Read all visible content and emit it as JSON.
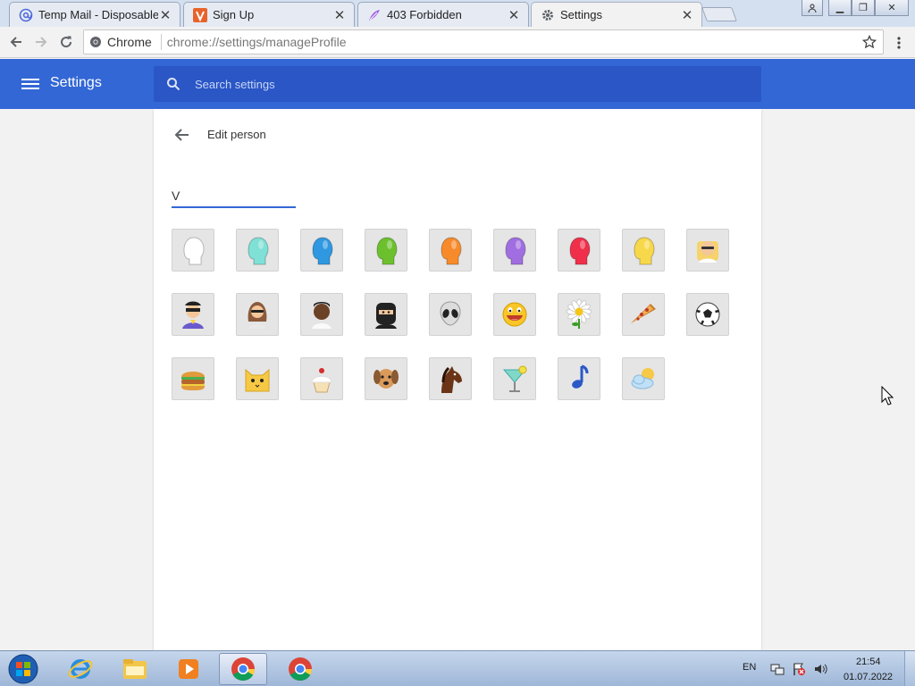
{
  "browser": {
    "tabs": [
      {
        "title": "Temp Mail - Disposable T",
        "icon": "at-icon"
      },
      {
        "title": "Sign Up",
        "icon": "v-logo-icon"
      },
      {
        "title": "403 Forbidden",
        "icon": "feather-icon"
      },
      {
        "title": "Settings",
        "icon": "gear-icon",
        "active": true
      }
    ],
    "omnibox": {
      "chip": "Chrome",
      "url": "chrome://settings/manageProfile"
    }
  },
  "settings": {
    "title": "Settings",
    "search_placeholder": "Search settings"
  },
  "edit_person": {
    "title": "Edit person",
    "name_value": "V",
    "avatars": [
      {
        "name": "avatar-generic-white",
        "icon": "head-silhouette-icon",
        "color": "#ffffff"
      },
      {
        "name": "avatar-generic-aqua",
        "icon": "head-silhouette-icon",
        "color": "#7fe0d6"
      },
      {
        "name": "avatar-generic-blue",
        "icon": "head-silhouette-icon",
        "color": "#2f98e0"
      },
      {
        "name": "avatar-generic-green",
        "icon": "head-silhouette-icon",
        "color": "#6cc02e"
      },
      {
        "name": "avatar-generic-orange",
        "icon": "head-silhouette-icon",
        "color": "#f78a2a"
      },
      {
        "name": "avatar-generic-purple",
        "icon": "head-silhouette-icon",
        "color": "#a06ee0"
      },
      {
        "name": "avatar-generic-red",
        "icon": "head-silhouette-icon",
        "color": "#f0304a"
      },
      {
        "name": "avatar-generic-yellow",
        "icon": "head-silhouette-icon",
        "color": "#f7d84a"
      },
      {
        "name": "avatar-businessman",
        "icon": "businessman-icon",
        "color": "#f3c79a"
      },
      {
        "name": "avatar-superhero",
        "icon": "superhero-icon",
        "color": "#6a5acd"
      },
      {
        "name": "avatar-superheroine",
        "icon": "superheroine-icon",
        "color": "#8b5a3c"
      },
      {
        "name": "avatar-bearded",
        "icon": "man-portrait-icon",
        "color": "#6b4226"
      },
      {
        "name": "avatar-ninja",
        "icon": "ninja-icon",
        "color": "#222222"
      },
      {
        "name": "avatar-alien",
        "icon": "alien-icon",
        "color": "#dcdcdc"
      },
      {
        "name": "avatar-awesome",
        "icon": "smiley-icon",
        "color": "#f8c627"
      },
      {
        "name": "avatar-flower",
        "icon": "flower-icon",
        "color": "#ffffff"
      },
      {
        "name": "avatar-pizza",
        "icon": "pizza-icon",
        "color": "#f2b24b"
      },
      {
        "name": "avatar-soccer",
        "icon": "soccer-ball-icon",
        "color": "#ffffff"
      },
      {
        "name": "avatar-burger",
        "icon": "burger-icon",
        "color": "#b5652a"
      },
      {
        "name": "avatar-cat",
        "icon": "cat-icon",
        "color": "#f7c843"
      },
      {
        "name": "avatar-cupcake",
        "icon": "cupcake-icon",
        "color": "#f6e0b5"
      },
      {
        "name": "avatar-dog",
        "icon": "dog-icon",
        "color": "#d99a5b"
      },
      {
        "name": "avatar-horse",
        "icon": "horse-icon",
        "color": "#6b3416"
      },
      {
        "name": "avatar-margarita",
        "icon": "cocktail-icon",
        "color": "#7fd8c8"
      },
      {
        "name": "avatar-note",
        "icon": "music-note-icon",
        "color": "#2b58c8"
      },
      {
        "name": "avatar-sun-cloud",
        "icon": "sun-cloud-icon",
        "color": "#bfe0f7"
      }
    ]
  },
  "taskbar": {
    "apps": [
      "windows-start-icon",
      "internet-explorer-icon",
      "file-explorer-icon",
      "media-player-icon",
      "chrome-icon",
      "chrome-icon"
    ],
    "language": "EN",
    "time": "21:54",
    "date": "01.07.2022"
  }
}
